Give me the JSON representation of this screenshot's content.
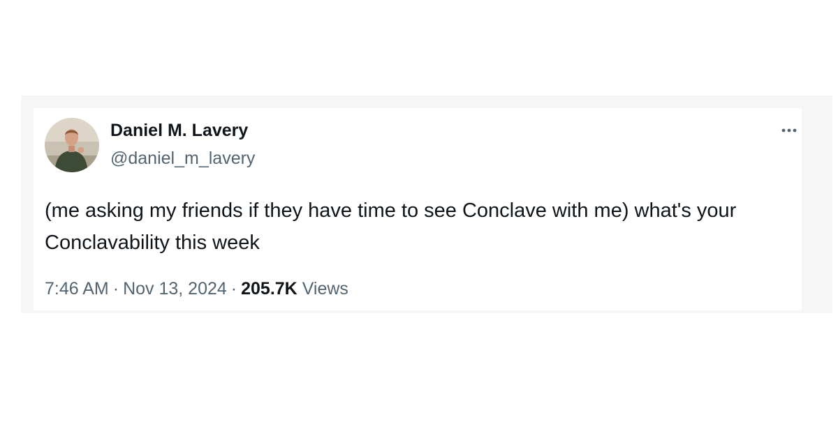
{
  "tweet": {
    "author": {
      "display_name": "Daniel M. Lavery",
      "handle": "@daniel_m_lavery",
      "avatar_icon": "profile-photo"
    },
    "menu_icon": "more-options-icon",
    "text": "(me asking my friends if they have time to see Conclave with me) what's your Conclavability this week",
    "time": "7:46 AM",
    "date": "Nov 13, 2024",
    "separator": "·",
    "views_count": "205.7K",
    "views_label": "Views"
  },
  "colors": {
    "primary_text": "#0f1419",
    "secondary_text": "#536471",
    "card_background": "#ffffff",
    "frame_background": "#f6f6f7"
  }
}
